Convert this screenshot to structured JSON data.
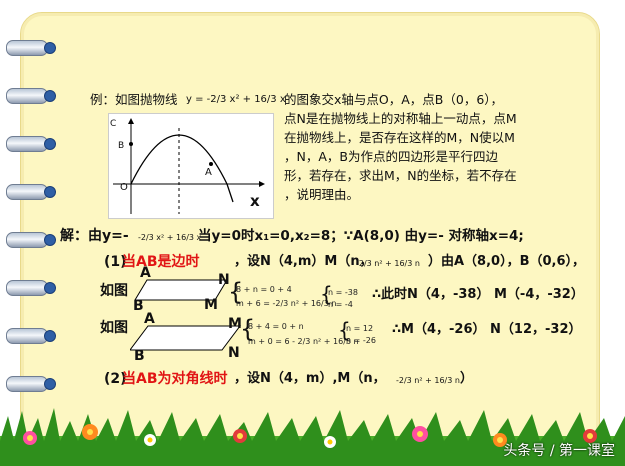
{
  "problem": {
    "line1_prefix": "例：如图抛物线",
    "parabola_formula": "y = -2/3 x² + 16/3 x",
    "line1_suffix": "的图象交x轴与点O，A，点B（0，6），",
    "line2": "点N是在抛物线上的对称轴上一动点，点M",
    "line3": "在抛物线上，是否存在这样的M，N使以M",
    "line4": "，N，A，B为作点的四边形是平行四边",
    "line5": "形，若存在，求出M，N的坐标，若不存在",
    "line6": "，说明理由。"
  },
  "graph_labels": {
    "c": "C",
    "b": "B",
    "o": "O",
    "a": "A",
    "x": "x"
  },
  "solution": {
    "line1_prefix": "解：由y=-",
    "line1_formula": "-2/3 x² + 16/3 x",
    "line1_mid": "当y=0时x₁=0,x₂=8；∵A(8,0) 由y=- 对称轴x=4;",
    "case1_label": "(1)",
    "case1_red": "当AB是边时",
    "case1_text": "，设N（4,m）M（n，",
    "case1_formula": "-2/3 n² + 16/3 n",
    "case1_tail": "）由A（8,0），B（0,6），",
    "as_shown_1": "如图",
    "eq1_top": "8 + n = 0 + 4",
    "eq1_bottom": "m + 6 = -2/3 n² + 16/3 n",
    "sol1_top": "n = -38",
    "sol1_bottom": "n = -4",
    "result1": "∴此时N（4，-38） M（-4，-32）",
    "as_shown_2": "如图",
    "eq2_top": "8 + 4 = 0 + n",
    "eq2_bottom": "m + 0 = 6 - 2/3 n² + 16/3 n",
    "sol2_top": "n = 12",
    "sol2_bottom": "n = -26",
    "result2": "∴M（4，-26） N（12，-32）",
    "case2_label": "(2)",
    "case2_red": "当AB为对角线时",
    "case2_text": "，设N（4，m）,M（n，",
    "case2_formula": "-2/3 n² + 16/3 n",
    "case2_tail": "）"
  },
  "fig1": {
    "a": "A",
    "n": "N",
    "b": "B",
    "m": "M"
  },
  "fig2": {
    "a": "A",
    "m": "M",
    "b": "B",
    "n": "N"
  },
  "watermark": "头条号 / 第一课室"
}
